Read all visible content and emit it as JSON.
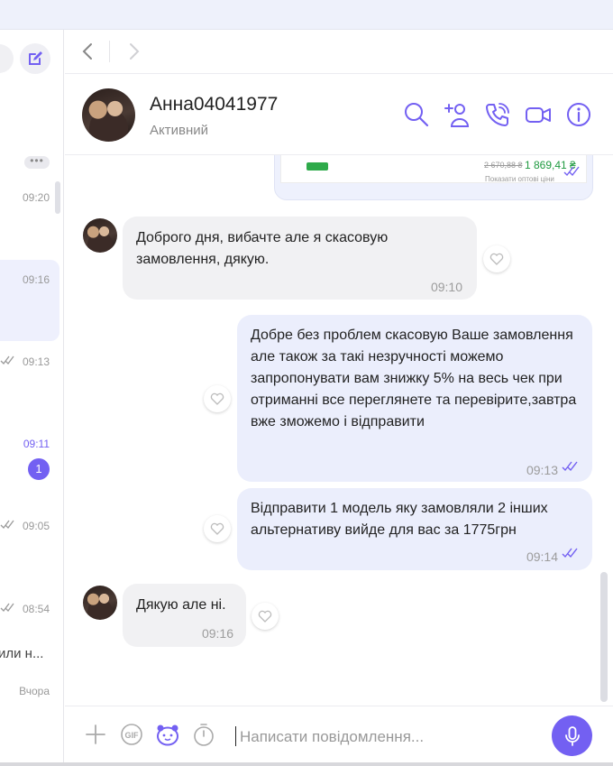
{
  "sidebar": {
    "more_label": "•••",
    "times": [
      "09:20",
      "09:16",
      "09:13",
      "09:11",
      "09:05",
      "08:54"
    ],
    "unread_count": "1",
    "snippet": "или н...",
    "yesterday": "Вчора"
  },
  "contact": {
    "name": "Анна04041977",
    "status": "Активний"
  },
  "image_message": {
    "old_price": "2 670,88 ₴",
    "new_price": "1 869,41 ₴",
    "link": "Показати оптові ціни"
  },
  "messages": [
    {
      "direction": "in",
      "text": "Доброго дня, вибачте але я скасовую замовлення, дякую.",
      "time": "09:10"
    },
    {
      "direction": "out",
      "text": "Добре без проблем скасовую Ваше замовлення але також за такі незручності можемо запропонувати вам знижку 5% на весь чек при отриманні все переглянете та перевірите,завтра вже зможемо і відправити",
      "time": "09:13"
    },
    {
      "direction": "out",
      "text": "Відправити 1 модель яку замовляли 2 інших альтернативу вийде для вас за 1775грн",
      "time": "09:14"
    },
    {
      "direction": "in",
      "text": "Дякую але ні.",
      "time": "09:16"
    }
  ],
  "composer": {
    "placeholder": "Написати повідомлення..."
  },
  "colors": {
    "accent": "#7360f2",
    "incoming_bubble": "#f1f1f3",
    "outgoing_bubble": "#ebeefc"
  },
  "icons": [
    "compose-icon",
    "back-icon",
    "forward-icon",
    "search-icon",
    "add-participant-icon",
    "call-icon",
    "video-call-icon",
    "info-icon",
    "like-icon",
    "read-ticks-icon",
    "plus-icon",
    "gif-icon",
    "sticker-icon",
    "timer-icon",
    "microphone-icon"
  ]
}
